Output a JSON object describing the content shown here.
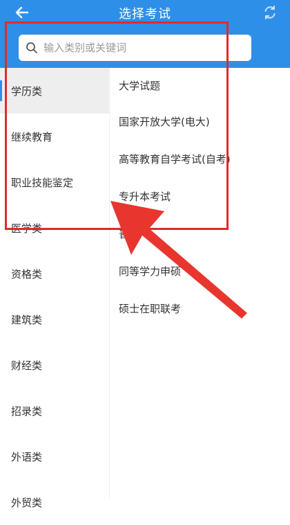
{
  "header": {
    "title": "选择考试",
    "back_icon": "back-arrow-icon",
    "refresh_icon": "refresh-icon"
  },
  "search": {
    "placeholder": "输入类别或关键词",
    "value": ""
  },
  "sidebar": {
    "items": [
      {
        "label": "学历类",
        "active": true
      },
      {
        "label": "继续教育"
      },
      {
        "label": "职业技能鉴定"
      },
      {
        "label": "医学类"
      },
      {
        "label": "资格类"
      },
      {
        "label": "建筑类"
      },
      {
        "label": "财经类"
      },
      {
        "label": "招录类"
      },
      {
        "label": "外语类"
      },
      {
        "label": "外贸类"
      }
    ]
  },
  "main": {
    "items": [
      {
        "label": "大学试题"
      },
      {
        "label": "国家开放大学(电大)"
      },
      {
        "label": "高等教育自学考试(自考)"
      },
      {
        "label": "专升本考试"
      },
      {
        "label": "普通"
      },
      {
        "label": "同等学力申硕"
      },
      {
        "label": "硕士在职联考"
      }
    ]
  },
  "colors": {
    "brand": "#2e8fe8",
    "annotation": "#e02a2a"
  }
}
